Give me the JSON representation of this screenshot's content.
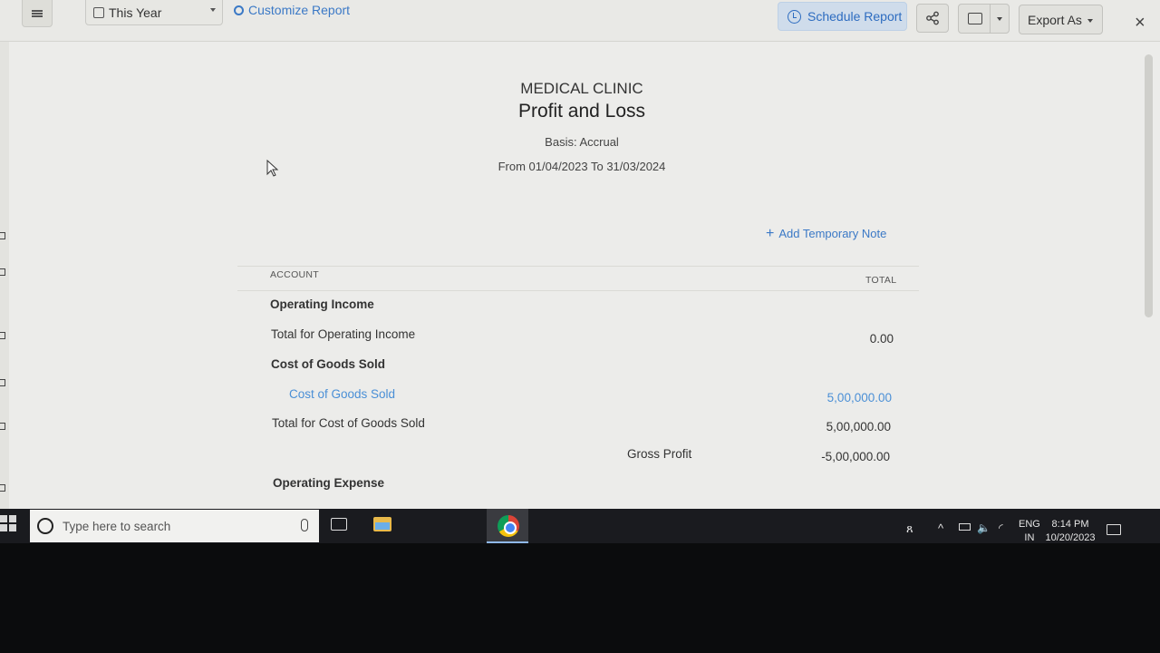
{
  "toolbar": {
    "period_label": "This Year",
    "customize_label": "Customize Report",
    "schedule_label": "Schedule Report",
    "export_label": "Export As",
    "close_glyph": "×"
  },
  "report": {
    "company": "MEDICAL CLINIC",
    "title": "Profit and Loss",
    "basis": "Basis: Accrual",
    "date_range": "From 01/04/2023 To 31/03/2024",
    "add_note": "Add Temporary Note",
    "add_note_glyph": "+",
    "col_account": "ACCOUNT",
    "col_total": "TOTAL",
    "rows": [
      {
        "label": "Operating Income",
        "amount": ""
      },
      {
        "label": "Total for Operating Income",
        "amount": "0.00"
      },
      {
        "label": "Cost of Goods Sold",
        "amount": ""
      },
      {
        "label": "Cost of Goods Sold",
        "amount": "5,00,000.00"
      },
      {
        "label": "Total for Cost of Goods Sold",
        "amount": "5,00,000.00"
      },
      {
        "label": "Gross Profit",
        "amount": "-5,00,000.00"
      },
      {
        "label": "Operating Expense",
        "amount": ""
      }
    ]
  },
  "taskbar": {
    "search_placeholder": "Type here to search",
    "lang_line1": "ENG",
    "lang_line2": "IN",
    "time": "8:14 PM",
    "date": "10/20/2023"
  },
  "colors": {
    "accent": "#3b79c6",
    "link": "#4a8fd6",
    "schedule_bg": "#cfdceb",
    "taskbar": "#1a1b1f"
  },
  "icons": {
    "menu": "hamburger-icon",
    "period": "calendar-icon",
    "customize": "gear-icon",
    "schedule": "clock-icon",
    "share": "share-icon",
    "print": "printer-icon",
    "close": "close-icon",
    "windows": "windows-logo-icon",
    "search": "cortana-ring-icon",
    "mic": "microphone-icon",
    "task_view": "task-view-icon",
    "file_explorer": "folder-icon",
    "chrome": "chrome-icon",
    "notifications": "notification-icon"
  }
}
